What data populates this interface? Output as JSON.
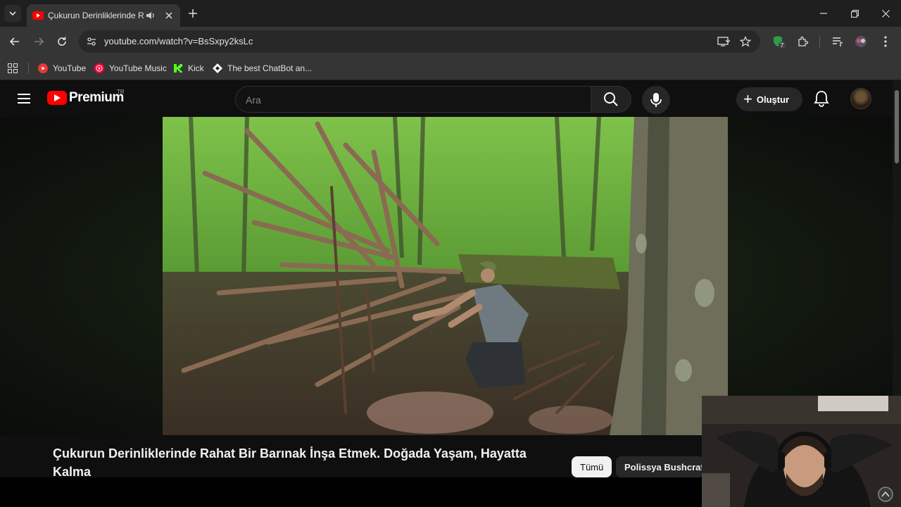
{
  "browser": {
    "tab": {
      "title": "Çukurun Derinliklerinde Rahat Bir Barınak İnşa Etmek. Doğada Yaşam, Hayatta Kalma - YouTube"
    },
    "url": "youtube.com/watch?v=BsSxpy2ksLc",
    "extension_badge": "7",
    "bookmarks": [
      {
        "label": "YouTube",
        "icon": "youtube-icon"
      },
      {
        "label": "YouTube Music",
        "icon": "youtube-music-icon"
      },
      {
        "label": "Kick",
        "icon": "kick-icon"
      },
      {
        "label": "The best ChatBot an...",
        "icon": "chatbot-icon"
      }
    ]
  },
  "youtube": {
    "logo_text": "Premium",
    "country_code": "TR",
    "search_placeholder": "Ara",
    "create_label": "Oluştur",
    "video_title": "Çukurun Derinliklerinde Rahat Bir Barınak İnşa Etmek. Doğada Yaşam, Hayatta Kalma",
    "chips": [
      {
        "label": "Tümü",
        "selected": true
      },
      {
        "label": "Polissya Bushcraft",
        "selected": false
      }
    ]
  },
  "colors": {
    "brand": "#ff0000",
    "bg": "#0f0f0f",
    "chrome_toolbar": "#353535"
  }
}
